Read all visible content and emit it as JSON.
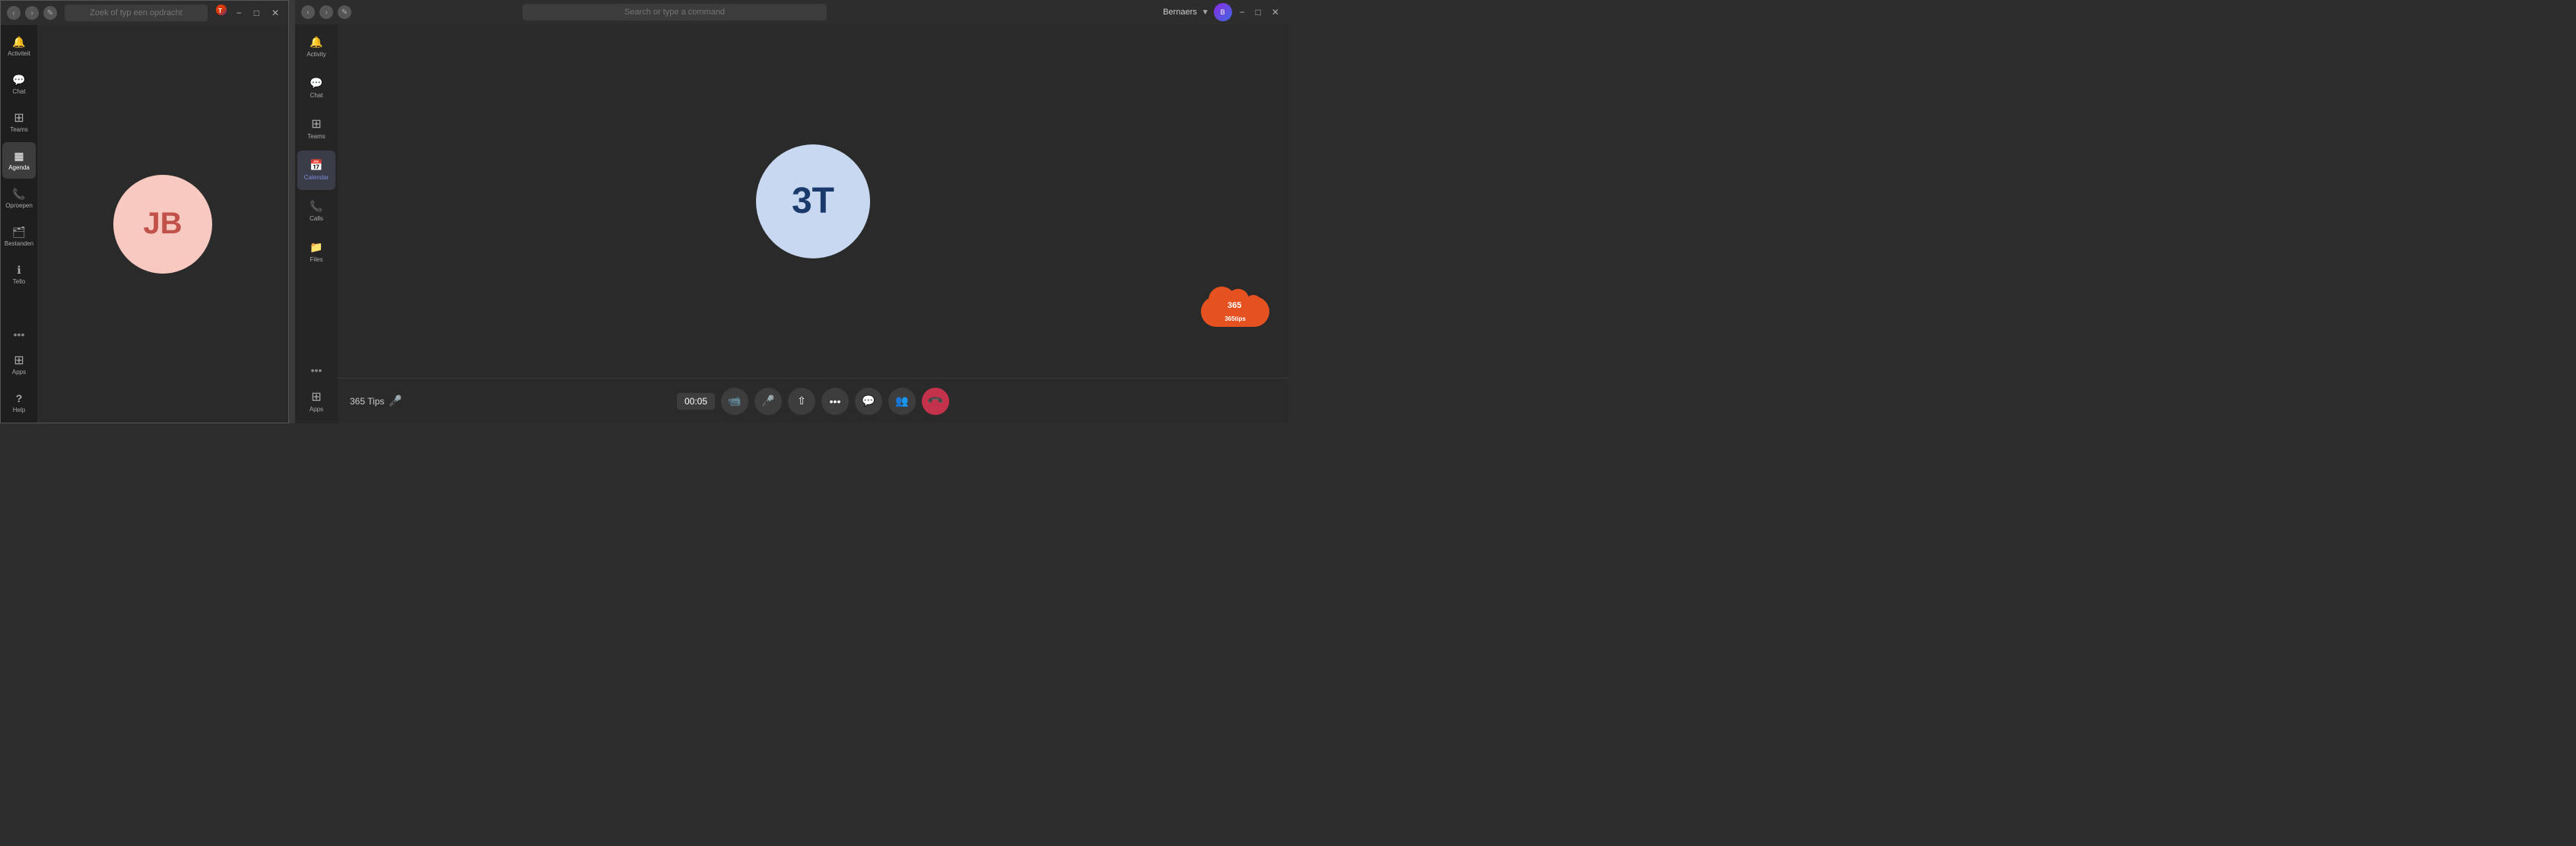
{
  "leftWindow": {
    "titlebar": {
      "searchPlaceholder": "Zoek of typ een opdracht",
      "searchValue": "Zoek of typ een opdracht"
    },
    "sidebar": {
      "items": [
        {
          "id": "activity",
          "label": "Activiteit",
          "iconClass": "icon-activity"
        },
        {
          "id": "chat",
          "label": "Chat",
          "iconClass": "icon-chat"
        },
        {
          "id": "teams",
          "label": "Teams",
          "iconClass": "icon-teams"
        },
        {
          "id": "agenda",
          "label": "Agenda",
          "iconClass": "icon-agenda",
          "active": true
        },
        {
          "id": "oproepen",
          "label": "Oproepen",
          "iconClass": "icon-calls"
        },
        {
          "id": "bestanden",
          "label": "Bestanden",
          "iconClass": "icon-bestanden"
        },
        {
          "id": "tello",
          "label": "Tello",
          "iconClass": "icon-info"
        }
      ],
      "bottomItems": [
        {
          "id": "apps",
          "label": "Apps",
          "iconClass": "icon-apps"
        },
        {
          "id": "help",
          "label": "Help",
          "iconClass": "icon-help"
        }
      ]
    },
    "avatar": {
      "initials": "JB",
      "bgColor": "#f8c9c0",
      "textColor": "#c0524a"
    }
  },
  "rightWindow": {
    "titlebar": {
      "searchPlaceholder": "Search or type a command",
      "username": "Bernaers",
      "avatarInitials": "B"
    },
    "sidebar": {
      "items": [
        {
          "id": "activity",
          "label": "Activity",
          "iconClass": "icon-activity"
        },
        {
          "id": "chat",
          "label": "Chat",
          "iconClass": "icon-chat"
        },
        {
          "id": "teams",
          "label": "Teams",
          "iconClass": "icon-teams"
        },
        {
          "id": "calendar",
          "label": "Calendar",
          "iconClass": "icon-calendar",
          "active": true
        },
        {
          "id": "calls",
          "label": "Calls",
          "iconClass": "icon-calls"
        },
        {
          "id": "files",
          "label": "Files",
          "iconClass": "icon-files"
        }
      ],
      "bottomItems": [
        {
          "id": "apps",
          "label": "Apps",
          "iconClass": "icon-apps"
        }
      ],
      "moreButton": "•••"
    },
    "call": {
      "avatarInitials": "3T",
      "avatarBg": "#c8d8f0",
      "avatarTextColor": "#1a3a6b",
      "callerLabel": "365 Tips",
      "timer": "00:05"
    },
    "cloudLogo": {
      "text": "365tips",
      "iconLabel": "365"
    },
    "controls": [
      {
        "id": "video",
        "icon": "📹",
        "label": "video"
      },
      {
        "id": "mic",
        "icon": "🎤",
        "label": "mic"
      },
      {
        "id": "share",
        "icon": "⬆",
        "label": "share screen"
      },
      {
        "id": "more",
        "icon": "•••",
        "label": "more options"
      },
      {
        "id": "chat",
        "icon": "💬",
        "label": "chat"
      },
      {
        "id": "participants",
        "icon": "👥",
        "label": "participants"
      },
      {
        "id": "end-call",
        "icon": "📞",
        "label": "end call"
      }
    ]
  }
}
